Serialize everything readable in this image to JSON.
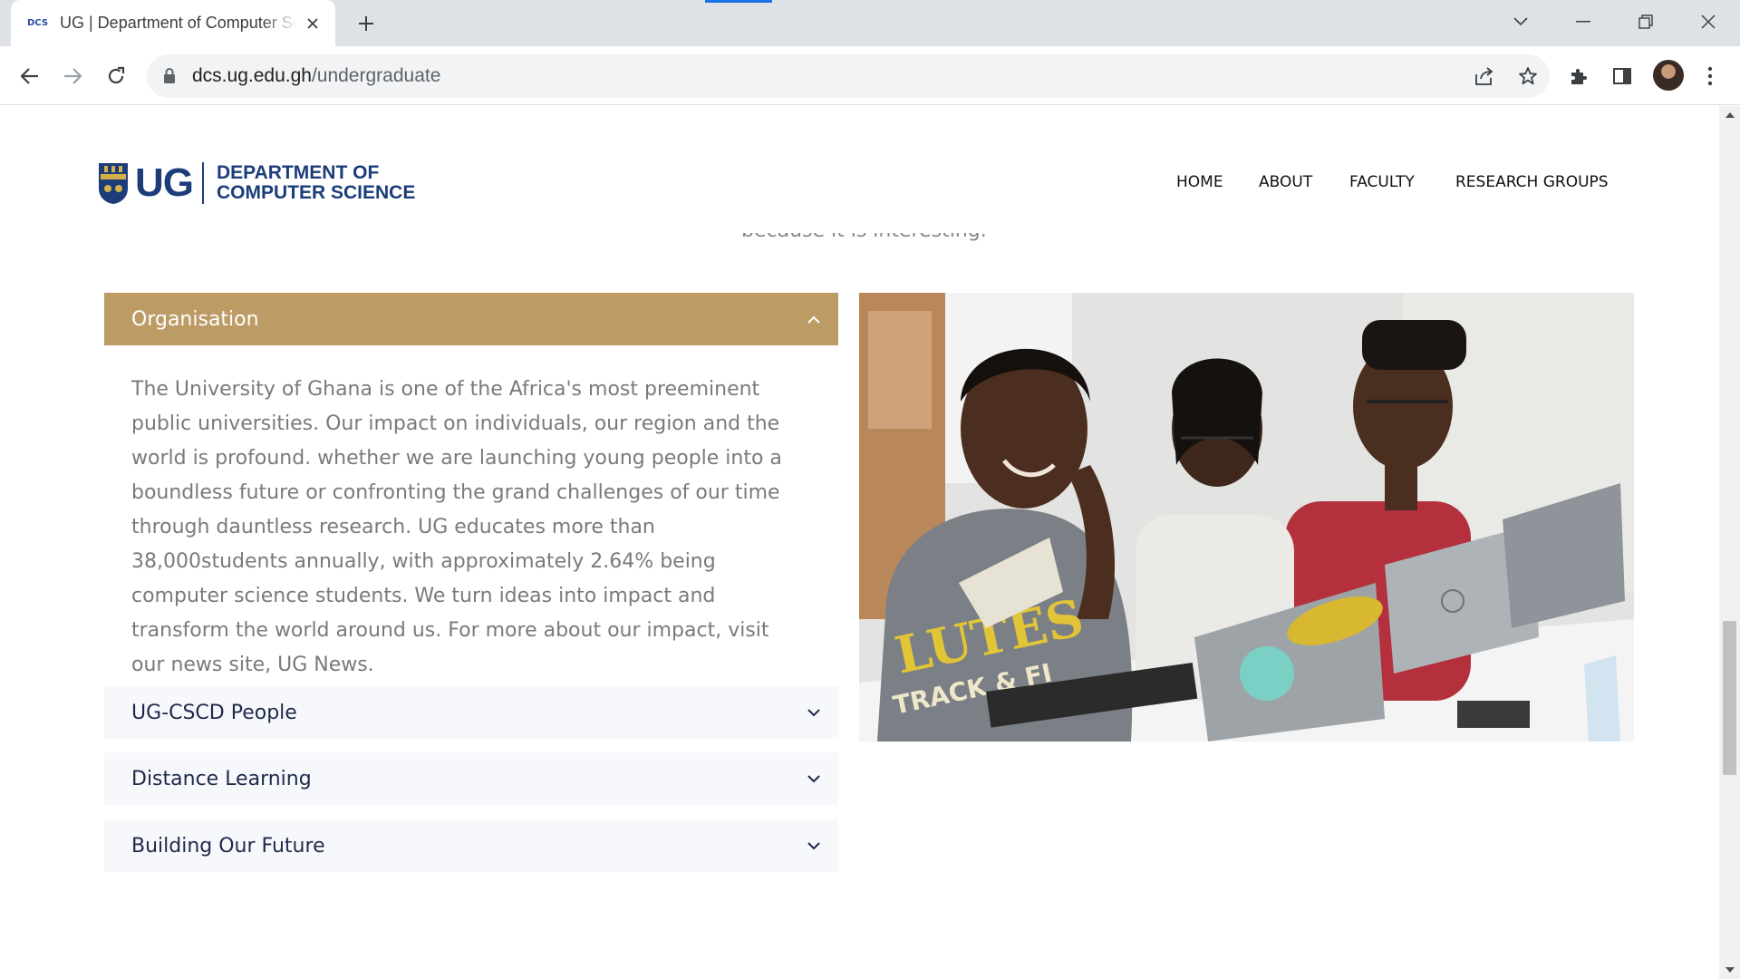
{
  "browser": {
    "tab_title": "UG | Department of Computer Science",
    "favicon_text": "DCS",
    "url_host": "dcs.ug.edu.gh",
    "url_path": "/undergraduate"
  },
  "site": {
    "logo_ug": "UG",
    "logo_line1": "DEPARTMENT OF",
    "logo_line2": "COMPUTER SCIENCE",
    "nav": [
      "HOME",
      "ABOUT",
      "FACULTY",
      "RESEARCH GROUPS"
    ],
    "faded_text": "because it is interesting."
  },
  "accordion": {
    "open_title": "Organisation",
    "open_body": "The University of Ghana is one of the Africa's most preeminent public universities. Our impact on individuals, our region and the world is profound. whether we are launching young people into a boundless future or confronting the grand challenges of our time through dauntless research. UG educates more than 38,000students annually, with approximately 2.64% being computer science students. We turn ideas into impact and transform the world around us. For more about our impact, visit our news site, UG News.",
    "closed_items": [
      "UG-CSCD People",
      "Distance Learning",
      "Building Our Future"
    ]
  },
  "photo": {
    "shirt_text_1": "LUTES",
    "shirt_text_2": "TRACK & FI"
  },
  "colors": {
    "accent": "#bc9b65",
    "brand_blue": "#1c3d7a",
    "closed_panel": "#f7f8fc"
  }
}
